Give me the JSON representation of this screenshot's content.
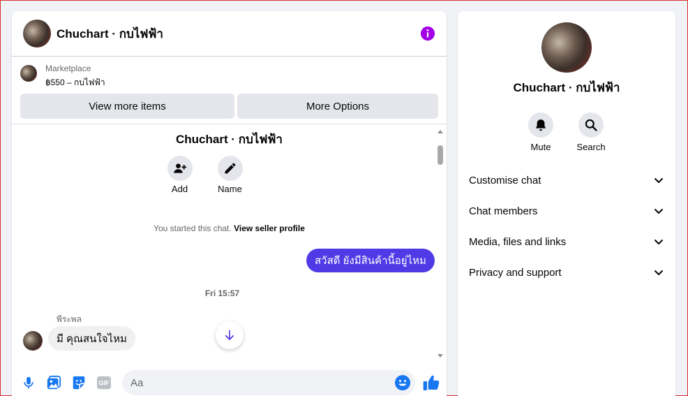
{
  "chat": {
    "title": "Chuchart · กบไฟฟ้า",
    "marketplace_label": "Marketplace",
    "listing_price": "฿550 – กบไฟฟ้า",
    "view_more_label": "View more items",
    "more_options_label": "More Options"
  },
  "conversation": {
    "title": "Chuchart · กบไฟฟ้า",
    "actions": [
      {
        "label": "Add",
        "icon": "add-person-icon"
      },
      {
        "label": "Name",
        "icon": "pencil-icon"
      }
    ],
    "started_text": "You started this chat.",
    "seller_link": "View seller profile",
    "outgoing_message": "สวัสดี ยังมีสินค้านี้อยู่ไหม",
    "timestamp": "Fri 15:57",
    "sender_name": "พีระพล",
    "incoming_message": "มี คุณสนใจไหม"
  },
  "composer": {
    "placeholder": "Aa",
    "value": "",
    "gif_label": "GIF",
    "icons": [
      "microphone-icon",
      "image-icon",
      "sticker-icon",
      "gif-icon",
      "emoji-icon",
      "thumbs-up-icon"
    ]
  },
  "sidebar": {
    "name": "Chuchart · กบไฟฟ้า",
    "actions": [
      {
        "label": "Mute",
        "icon": "bell-icon"
      },
      {
        "label": "Search",
        "icon": "search-icon"
      }
    ],
    "menu": [
      {
        "label": "Customise chat"
      },
      {
        "label": "Chat members"
      },
      {
        "label": "Media, files and links"
      },
      {
        "label": "Privacy and support"
      }
    ]
  },
  "colors": {
    "accent": "#4f3ae6",
    "info_icon": "#a400e6",
    "composer_icons": "#1877f2"
  }
}
